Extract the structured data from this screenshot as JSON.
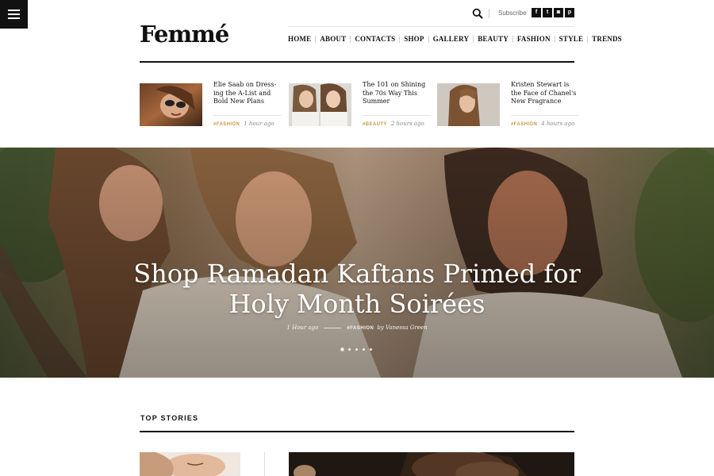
{
  "brand": {
    "logo": "Femmé"
  },
  "utility": {
    "subscribe": "Subscribe",
    "social": [
      {
        "icon": "facebook-icon",
        "glyph": "f"
      },
      {
        "icon": "twitter-icon",
        "glyph": "t"
      },
      {
        "icon": "instagram-icon",
        "glyph": "◙"
      },
      {
        "icon": "pinterest-icon",
        "glyph": "p"
      }
    ]
  },
  "nav": {
    "items": [
      "HOME",
      "ABOUT",
      "CONTACTS",
      "SHOP",
      "GALLERY",
      "BEAUTY",
      "FASHION",
      "STYLE",
      "TRENDS"
    ]
  },
  "mini_posts": [
    {
      "title": "Elie Saab on Dress-ing the A-List and Bold New Plans",
      "tag": "#FASHION",
      "time": "1 hour ago"
    },
    {
      "title": "The 101 on Shining the 70s Way This Summer",
      "tag": "#BEAUTY",
      "time": "2 hours ago"
    },
    {
      "title": "Kristen Stewart is the Face of Chanel's New Fragrance",
      "tag": "#FASHION",
      "time": "4 hours ago"
    }
  ],
  "hero": {
    "title": "Shop Ramadan Kaftans Primed for Holy Month Soirées",
    "time": "1 Hour ago",
    "tag": "#FASHION",
    "byline": "by Vanessa Green",
    "slide_count": 5,
    "active_slide": 1
  },
  "top_stories": {
    "title": "TOP STORIES"
  },
  "colors": {
    "accent": "#c89a4a",
    "text": "#111111",
    "menu_bg": "#111111"
  }
}
